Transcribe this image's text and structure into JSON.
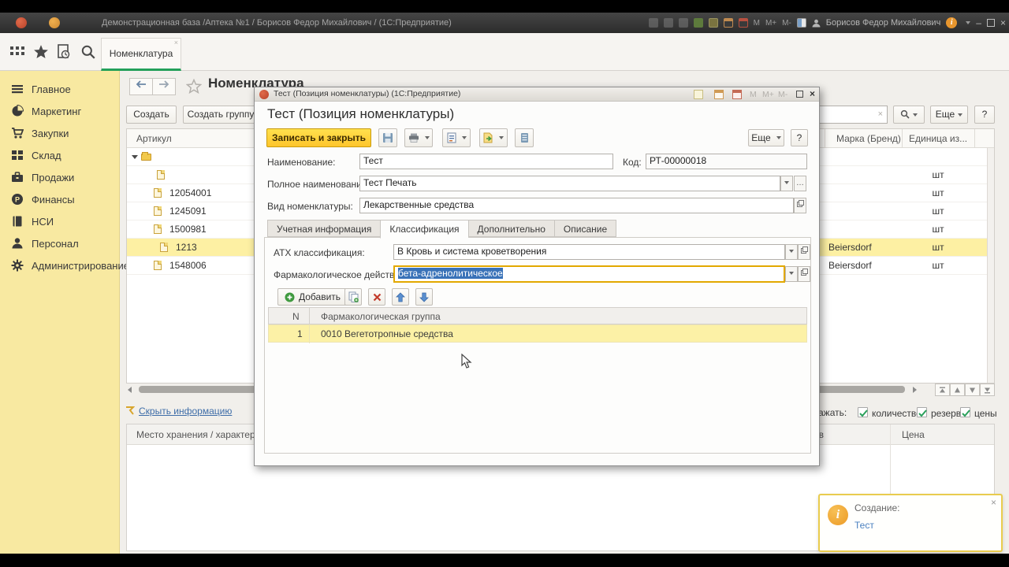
{
  "titlebar": {
    "app_title": "Демонстрационная база /Аптека №1 / Борисов Федор Михайлович /  (1С:Предприятие)",
    "memory_m": "M",
    "memory_mplus": "M+",
    "memory_mminus": "M-",
    "user_name": "Борисов Федор Михайлович"
  },
  "tabs": {
    "nomenclature": "Номенклатура"
  },
  "sidebar": {
    "items": [
      {
        "label": "Главное"
      },
      {
        "label": "Маркетинг"
      },
      {
        "label": "Закупки"
      },
      {
        "label": "Склад"
      },
      {
        "label": "Продажи"
      },
      {
        "label": "Финансы"
      },
      {
        "label": "НСИ"
      },
      {
        "label": "Персонал"
      },
      {
        "label": "Администрирование"
      }
    ]
  },
  "list": {
    "title": "Номенклатура",
    "create_button": "Создать",
    "create_group_button": "Создать группу",
    "more_button": "Еще",
    "help_button": "?",
    "columns": {
      "articul": "Артикул",
      "brand": "Марка (Бренд)",
      "unit": "Единица из..."
    },
    "rows": [
      {
        "articul": "",
        "brand": "",
        "unit": ""
      },
      {
        "articul": "",
        "brand": "",
        "unit": "шт"
      },
      {
        "articul": "12054001",
        "brand": "",
        "unit": "шт"
      },
      {
        "articul": "1245091",
        "brand": "",
        "unit": "шт"
      },
      {
        "articul": "1500981",
        "brand": "",
        "unit": "шт"
      },
      {
        "articul": "1213",
        "brand": "Beiersdorf",
        "unit": "шт"
      },
      {
        "articul": "1548006",
        "brand": "Beiersdorf",
        "unit": "шт"
      }
    ],
    "footer": {
      "hide_info_link": "Скрыть информацию",
      "storage_header": "Место хранения / характеристика",
      "display_label": "отображать:",
      "checkbox_quantity": "количество",
      "checkbox_reserve": "резерв",
      "checkbox_prices": "цены",
      "reserve_column": "Резерв",
      "price_column": "Цена"
    }
  },
  "dialog": {
    "window_title": "Тест (Позиция номенклатуры)  (1С:Предприятие)",
    "memory_m": "M",
    "memory_mplus": "M+",
    "memory_mminus": "M-",
    "heading": "Тест (Позиция номенклатуры)",
    "save_close_button": "Записать и закрыть",
    "more_button": "Еще",
    "help_button": "?",
    "name_label": "Наименование:",
    "name_value": "Тест",
    "code_label": "Код:",
    "code_value": "РТ-00000018",
    "full_name_label": "Полное наименование:",
    "full_name_value": "Тест Печать",
    "kind_label": "Вид номенклатуры:",
    "kind_value": "Лекарственные средства",
    "tabs": [
      {
        "label": "Учетная информация"
      },
      {
        "label": "Классификация"
      },
      {
        "label": "Дополнительно"
      },
      {
        "label": "Описание"
      }
    ],
    "atx_label": "АТХ классификация:",
    "atx_value": "В Кровь и система кроветворения",
    "pharm_label": "Фармакологическое действие:",
    "pharm_value": "бета-адренолитическое",
    "add_button": "Добавить",
    "table": {
      "col_n": "N",
      "col_group": "Фармакологическая группа",
      "rows": [
        {
          "n": "1",
          "group": "0010 Вегетотропные средства"
        }
      ]
    }
  },
  "notification": {
    "title": "Создание:",
    "link": "Тест"
  },
  "colors": {
    "sidebar_yellow": "#f8e9a1",
    "selection_yellow": "#fdf0a3",
    "accent_button_yellow": "#fed23c",
    "tab_green": "#24a05a",
    "link_blue": "#3e6da8",
    "notification_border": "#e9cc4e"
  }
}
